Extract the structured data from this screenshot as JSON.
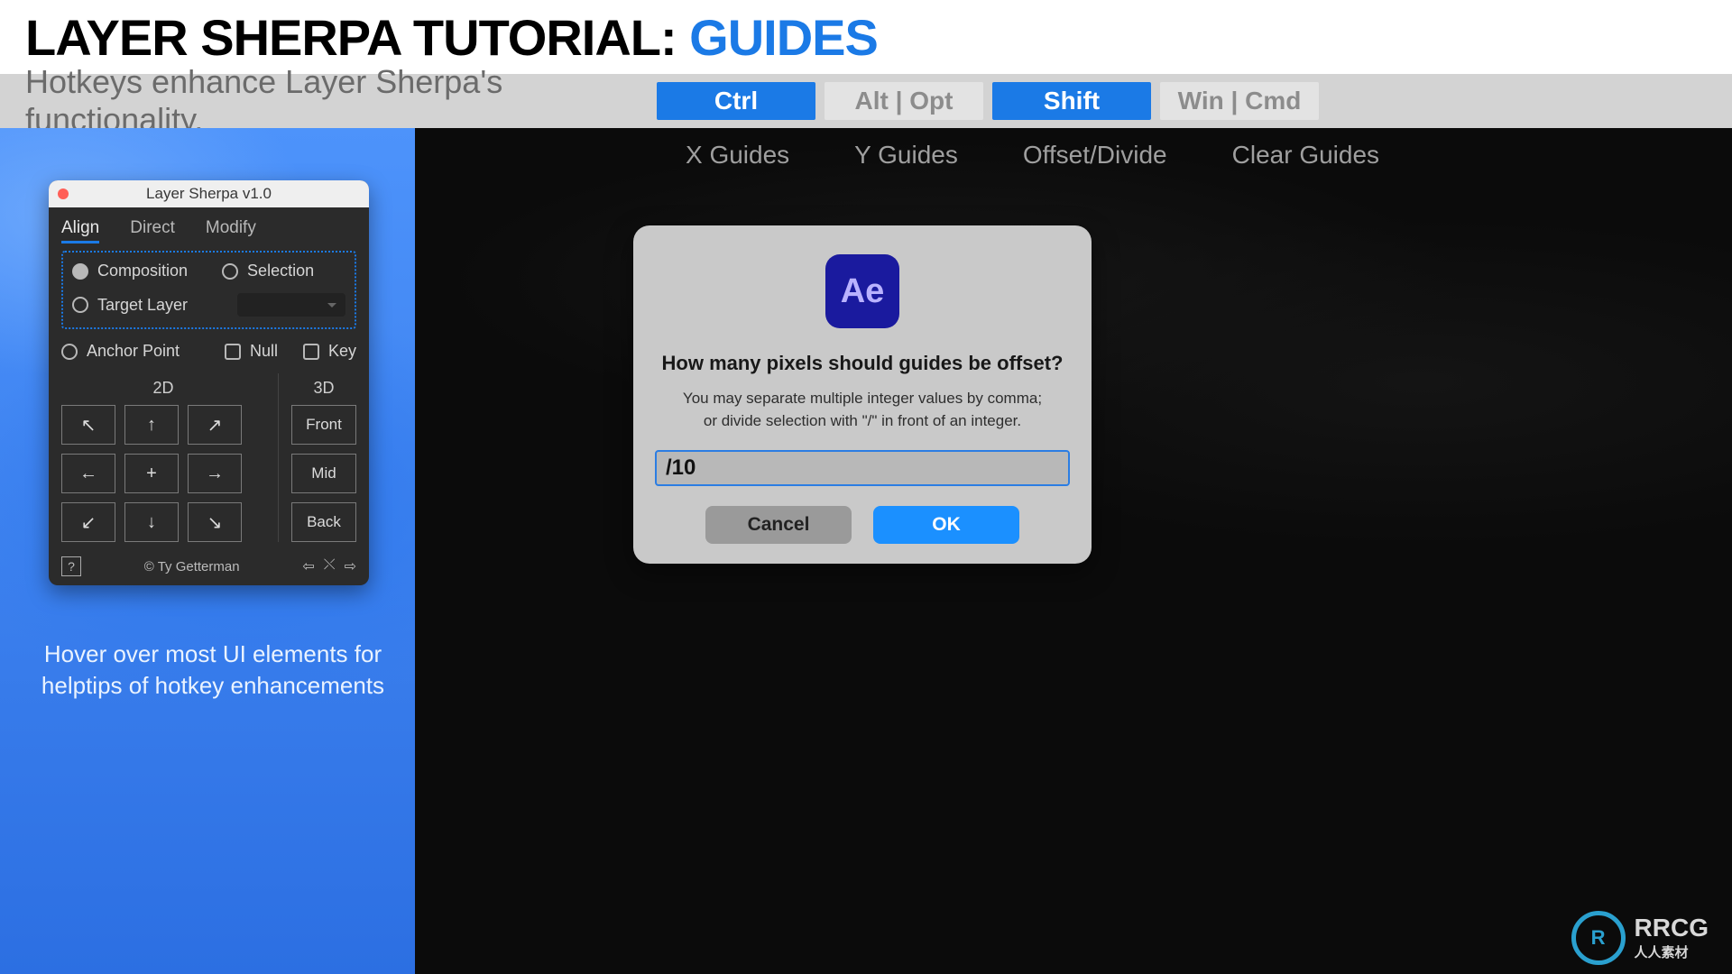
{
  "title": {
    "part1": "LAYER SHERPA TUTORIAL: ",
    "part2": "GUIDES"
  },
  "hotkey_desc": "Hotkeys enhance Layer Sherpa's functionality.",
  "hotkeys": [
    {
      "label": "Ctrl",
      "active": true
    },
    {
      "label": "Alt | Opt",
      "active": false
    },
    {
      "label": "Shift",
      "active": true
    },
    {
      "label": "Win | Cmd",
      "active": false
    }
  ],
  "guides_menu": [
    "X Guides",
    "Y Guides",
    "Offset/Divide",
    "Clear Guides"
  ],
  "plugin": {
    "window_title": "Layer Sherpa v1.0",
    "tabs": [
      {
        "label": "Align",
        "active": true
      },
      {
        "label": "Direct",
        "active": false
      },
      {
        "label": "Modify",
        "active": false
      }
    ],
    "radios": {
      "composition": "Composition",
      "selection": "Selection",
      "target_layer": "Target Layer"
    },
    "anchor_point": "Anchor Point",
    "null_label": "Null",
    "key_label": "Key",
    "col2d_label": "2D",
    "col3d_label": "3D",
    "grid2d": [
      "↖",
      "↑",
      "↗",
      "←",
      "+",
      "→",
      "↙",
      "↓",
      "↘"
    ],
    "grid3d": [
      "Front",
      "Mid",
      "Back"
    ],
    "help": "?",
    "copyright": "© Ty Getterman",
    "nav": [
      "⇦",
      "⤬",
      "⇨"
    ]
  },
  "hint1": "Hover over most UI elements for",
  "hint2": "helptips of hotkey enhancements",
  "dialog": {
    "icon_text": "Ae",
    "title": "How many pixels should guides be offset?",
    "sub1": "You may separate multiple integer values by comma;",
    "sub2": "or divide selection with \"/\" in front of an integer.",
    "input_value": "/10",
    "cancel": "Cancel",
    "ok": "OK"
  },
  "watermark": {
    "ring": "R",
    "text": "RRCG",
    "sub": "人人素材"
  }
}
